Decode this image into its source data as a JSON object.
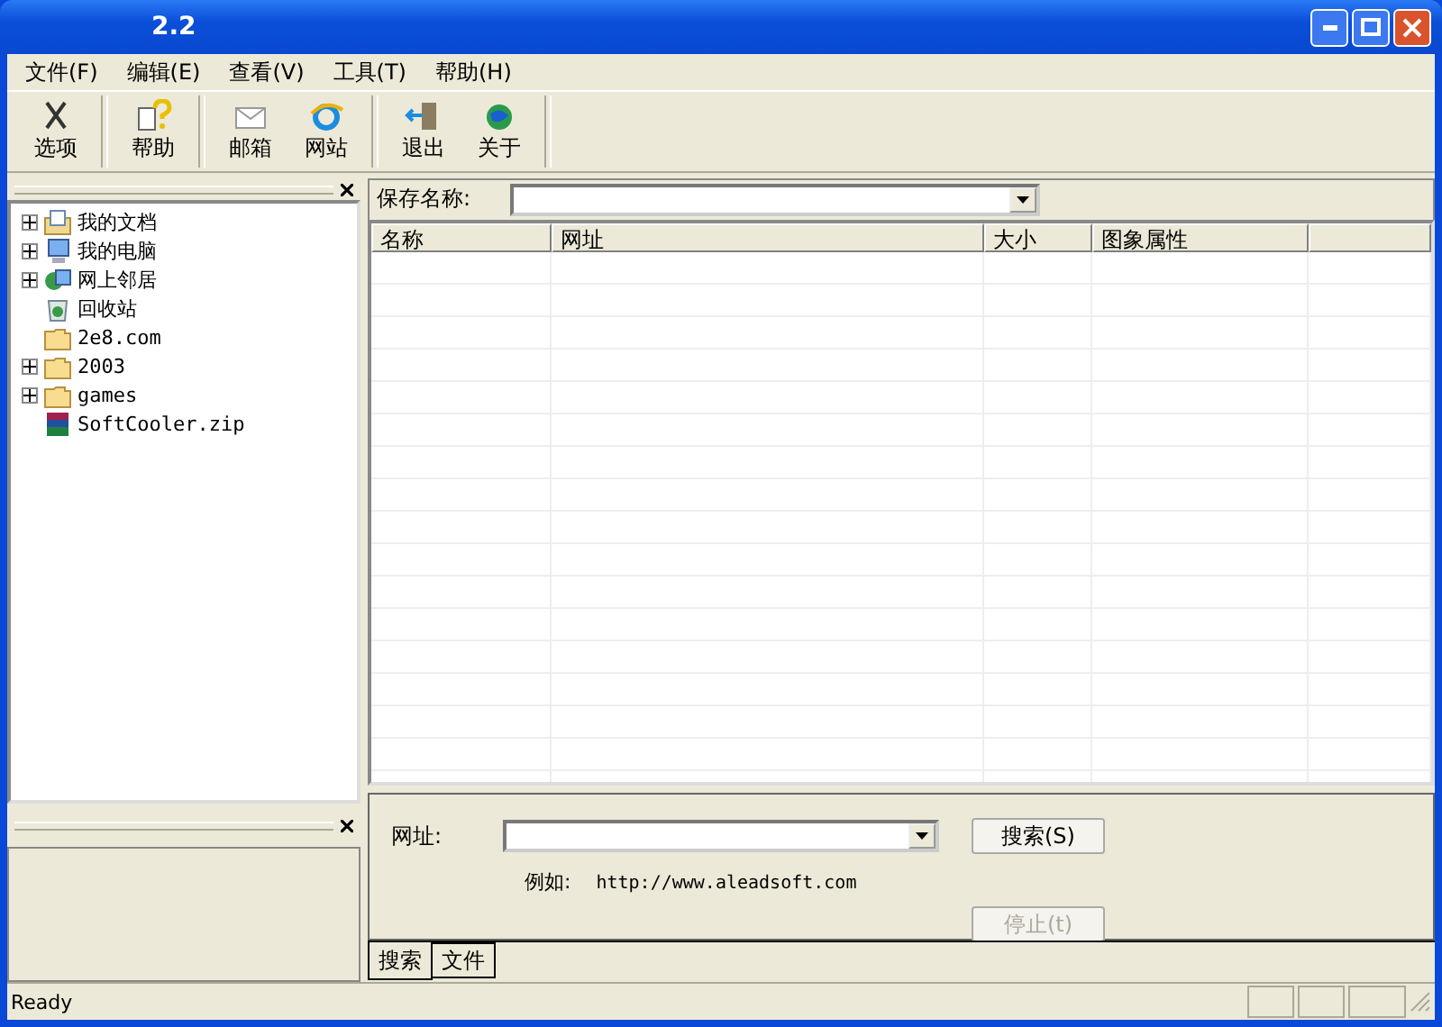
{
  "window": {
    "title": "2.2"
  },
  "menu": [
    {
      "label": "文件(F)"
    },
    {
      "label": "编辑(E)"
    },
    {
      "label": "查看(V)"
    },
    {
      "label": "工具(T)"
    },
    {
      "label": "帮助(H)"
    }
  ],
  "toolbar": {
    "groups": [
      [
        {
          "label": "选项",
          "kind": "tools"
        }
      ],
      [
        {
          "label": "帮助",
          "kind": "help"
        }
      ],
      [
        {
          "label": "邮箱",
          "kind": "mail"
        },
        {
          "label": "网站",
          "kind": "web"
        }
      ],
      [
        {
          "label": "退出",
          "kind": "exit"
        },
        {
          "label": "关于",
          "kind": "about"
        }
      ]
    ]
  },
  "tree": [
    {
      "label": "我的文档",
      "kind": "documents",
      "expandable": true
    },
    {
      "label": "我的电脑",
      "kind": "computer",
      "expandable": true
    },
    {
      "label": "网上邻居",
      "kind": "network",
      "expandable": true
    },
    {
      "label": "回收站",
      "kind": "recycle",
      "expandable": false
    },
    {
      "label": "2e8.com",
      "kind": "folder",
      "expandable": false
    },
    {
      "label": "2003",
      "kind": "folder",
      "expandable": true
    },
    {
      "label": "games",
      "kind": "folder",
      "expandable": true
    },
    {
      "label": "SoftCooler.zip",
      "kind": "archive",
      "expandable": false
    }
  ],
  "save_name": {
    "label": "保存名称:"
  },
  "table": {
    "columns": [
      "名称",
      "网址",
      "大小",
      "图象属性"
    ]
  },
  "search": {
    "url_label": "网址:",
    "example_label": "例如:",
    "example": "http://www.aleadsoft.com",
    "buttons": [
      {
        "label": "搜索(S)",
        "disabled": false
      },
      {
        "label": "停止(t)",
        "disabled": true
      }
    ]
  },
  "tabs": [
    {
      "label": "搜索",
      "selected": true
    },
    {
      "label": "文件",
      "selected": false
    }
  ],
  "status_bar": {
    "text": "Ready"
  }
}
